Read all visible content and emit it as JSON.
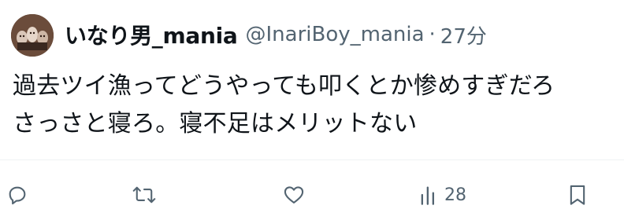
{
  "tweet": {
    "display_name": "いなり男_mania",
    "handle": "@InariBoy_mania",
    "separator": "·",
    "time": "27分",
    "lines": [
      "過去ツイ漁ってどうやっても叩くとか惨めすぎだろ",
      "さっさと寝ろ。寝不足はメリットない"
    ]
  },
  "actions": {
    "reply_icon": "reply-icon",
    "retweet_icon": "retweet-icon",
    "like_icon": "heart-icon",
    "views_icon": "views-icon",
    "views_count": "28",
    "bookmark_icon": "bookmark-icon"
  },
  "colors": {
    "text_primary": "#0f1419",
    "text_secondary": "#536471",
    "divider": "#eff3f4"
  }
}
